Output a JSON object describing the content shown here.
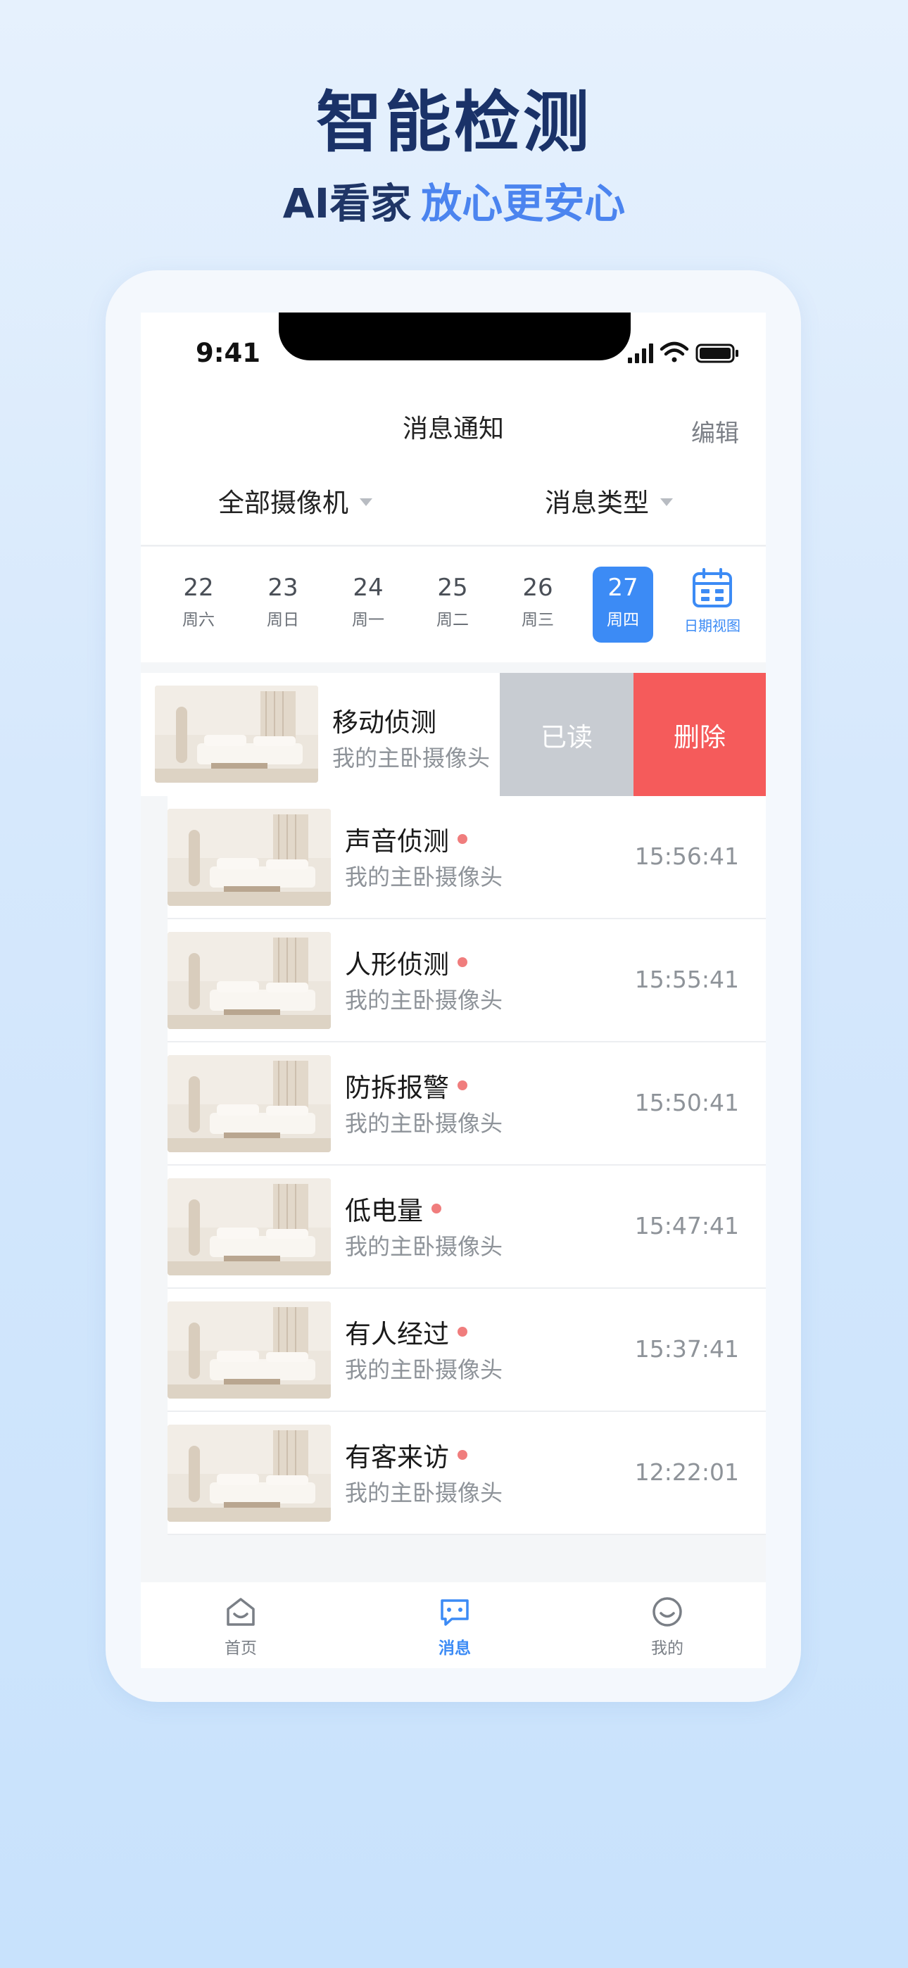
{
  "hero": {
    "title": "智能检测",
    "subtitle_part1": "AI看家",
    "subtitle_part2": "放心更安心"
  },
  "status": {
    "time": "9:41"
  },
  "header": {
    "title": "消息通知",
    "edit_label": "编辑"
  },
  "filters": {
    "camera": "全部摄像机",
    "type": "消息类型"
  },
  "dates": [
    {
      "day": "22",
      "weekday": "周六"
    },
    {
      "day": "23",
      "weekday": "周日"
    },
    {
      "day": "24",
      "weekday": "周一"
    },
    {
      "day": "25",
      "weekday": "周二"
    },
    {
      "day": "26",
      "weekday": "周三"
    },
    {
      "day": "27",
      "weekday": "周四",
      "selected": true
    }
  ],
  "calendar_view_label": "日期视图",
  "swiped_item": {
    "title": "移动侦测",
    "camera": "我的主卧摄像头",
    "read_label": "已读",
    "delete_label": "删除"
  },
  "messages": [
    {
      "title": "声音侦测",
      "camera": "我的主卧摄像头",
      "time": "15:56:41",
      "unread": true
    },
    {
      "title": "人形侦测",
      "camera": "我的主卧摄像头",
      "time": "15:55:41",
      "unread": true
    },
    {
      "title": "防拆报警",
      "camera": "我的主卧摄像头",
      "time": "15:50:41",
      "unread": true
    },
    {
      "title": "低电量",
      "camera": "我的主卧摄像头",
      "time": "15:47:41",
      "unread": true
    },
    {
      "title": "有人经过",
      "camera": "我的主卧摄像头",
      "time": "15:37:41",
      "unread": true
    },
    {
      "title": "有客来访",
      "camera": "我的主卧摄像头",
      "time": "12:22:01",
      "unread": true
    }
  ],
  "tabs": [
    {
      "label": "首页",
      "icon": "home-icon"
    },
    {
      "label": "消息",
      "icon": "message-icon",
      "active": true
    },
    {
      "label": "我的",
      "icon": "profile-icon"
    }
  ],
  "colors": {
    "accent": "#3c8bf5",
    "delete": "#f55b5b",
    "read": "#c8ccd2",
    "unread_dot": "#f07d7d",
    "title": "#1a3268"
  }
}
